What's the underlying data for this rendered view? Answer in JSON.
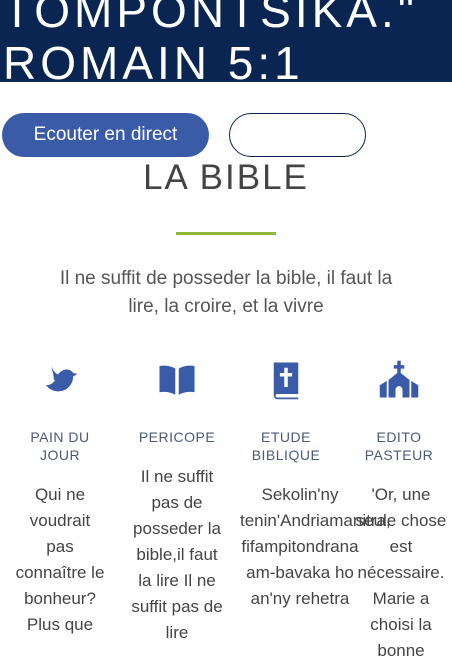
{
  "hero": {
    "line1": "TOMPONTSIKA.\"",
    "line2": "ROMAIN 5:1"
  },
  "buttons": {
    "listen_live": "Ecouter en direct",
    "secondary": ""
  },
  "section": {
    "title": "LA BIBLE",
    "tagline": "Il ne suffit de posseder la bible, il faut la lire, la croire, et la vivre"
  },
  "columns": [
    {
      "icon": "dove-icon",
      "title": "PAIN DU JOUR",
      "body": "Qui ne voudrait pas connaître le bonheur? Plus que"
    },
    {
      "icon": "open-book-icon",
      "title": "PERICOPE",
      "body": "Il ne suffit pas de posseder la bible,il faut la lire Il ne suffit pas de lire"
    },
    {
      "icon": "bible-cross-icon",
      "title": "ETUDE BIBLIQUE",
      "body": "Sekolin'ny tenin'Andriamanitra, fifampitondrana am-bavaka ho an'ny rehetra"
    },
    {
      "icon": "church-icon",
      "title": "EDITO PASTEUR",
      "body": "'Or, une seule chose est nécessaire. Marie a choisi la bonne"
    }
  ],
  "colors": {
    "hero_bg": "#0b2553",
    "accent": "#3a5ba8",
    "divider": "#8fb83a"
  }
}
